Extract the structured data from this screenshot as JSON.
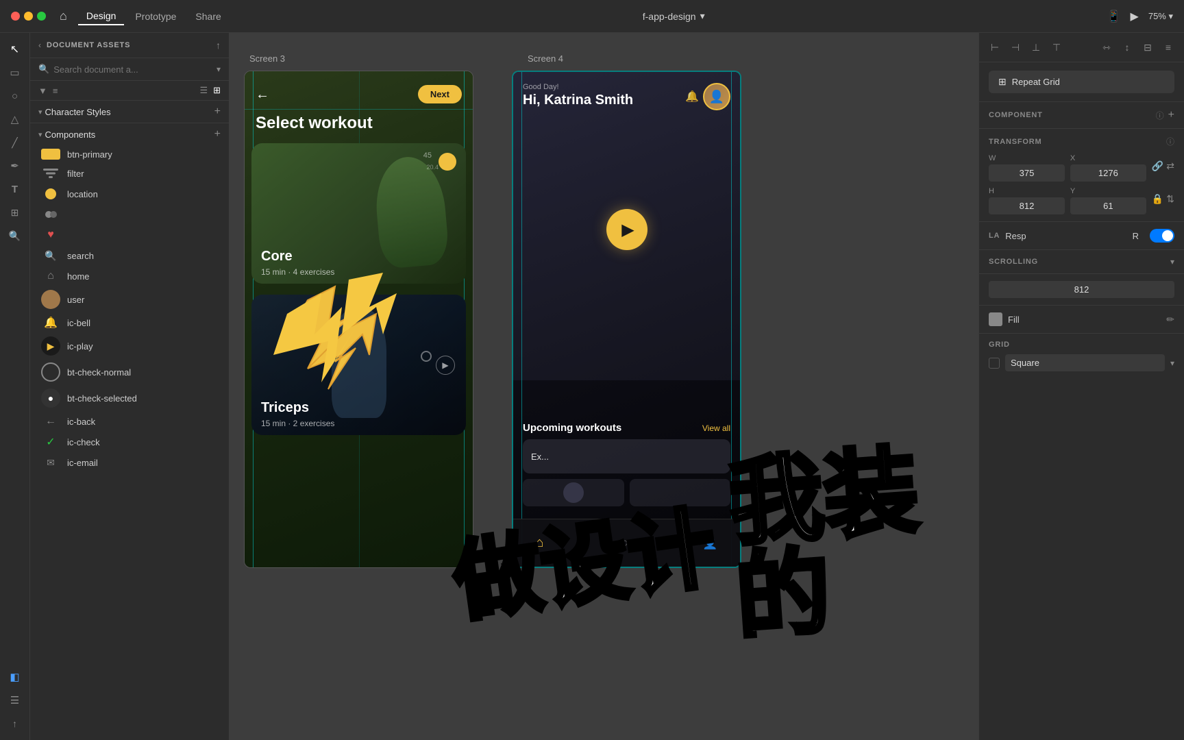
{
  "topbar": {
    "traffic": [
      "red",
      "yellow",
      "green"
    ],
    "nav_items": [
      "Design",
      "Prototype",
      "Share"
    ],
    "active_nav": "Design",
    "home_icon": "⌂",
    "title": "f-app-design",
    "title_arrow": "▾",
    "right_icons": [
      "📱",
      "▶",
      "75%",
      "▾"
    ]
  },
  "left_tools": {
    "tools": [
      {
        "name": "select",
        "icon": "↖",
        "active": true
      },
      {
        "name": "rectangle",
        "icon": "▭"
      },
      {
        "name": "ellipse",
        "icon": "○"
      },
      {
        "name": "polygon",
        "icon": "△"
      },
      {
        "name": "line",
        "icon": "╱"
      },
      {
        "name": "pen",
        "icon": "✒"
      },
      {
        "name": "text",
        "icon": "T"
      },
      {
        "name": "plugins",
        "icon": "⊞"
      },
      {
        "name": "search",
        "icon": "🔍"
      },
      {
        "name": "layers",
        "active": true,
        "icon": "◧"
      },
      {
        "name": "assets",
        "icon": "⊟"
      },
      {
        "name": "share",
        "icon": "↑"
      }
    ]
  },
  "sidebar": {
    "header_title": "DOCUMENT ASSETS",
    "search_placeholder": "Search document a...",
    "character_styles_label": "Character Styles",
    "components_label": "Components",
    "items": [
      {
        "name": "btn-primary",
        "type": "rect_yellow"
      },
      {
        "name": "filter",
        "type": "filter_icon"
      },
      {
        "name": "location",
        "type": "circle_yellow"
      },
      {
        "name": "user_stack",
        "type": "user_icon"
      },
      {
        "name": "heart",
        "type": "heart_icon"
      },
      {
        "name": "search",
        "type": "search_icon"
      },
      {
        "name": "home",
        "type": "home_icon"
      },
      {
        "name": "user",
        "type": "user_photo"
      },
      {
        "name": "ic-bell",
        "type": "bell_icon"
      },
      {
        "name": "ic-play",
        "type": "play_icon"
      },
      {
        "name": "bt-check-normal",
        "type": "check_normal"
      },
      {
        "name": "bt-check-selected",
        "type": "check_selected"
      },
      {
        "name": "ic-back",
        "type": "back_icon"
      },
      {
        "name": "ic-check",
        "type": "check_icon"
      },
      {
        "name": "ic-email",
        "type": "email_icon"
      }
    ]
  },
  "canvas": {
    "screen3": {
      "label": "Screen 3",
      "back_btn": "←",
      "next_btn": "Next",
      "title": "Select workout",
      "card1": {
        "title": "Core",
        "subtitle": "15 min · 4 exercises"
      },
      "card2": {
        "title": "Triceps",
        "subtitle": "15 min · 2 exercises"
      }
    },
    "screen4": {
      "label": "Screen 4",
      "good_day": "Good Day!",
      "greeting": "Hi, Katrina Smith",
      "upcoming_label": "Upcoming workouts",
      "view_all": "View all",
      "exercise_label": "Ex..."
    }
  },
  "right_panel": {
    "repeat_grid_label": "Repeat Grid",
    "component_label": "COMPONENT",
    "transform_label": "TRANSFORM",
    "w_label": "W",
    "h_label": "H",
    "x_label": "X",
    "y_label": "Y",
    "w_value": "375",
    "h_value": "812",
    "x_value": "1276",
    "y_value": "61",
    "layout_label": "LA",
    "responsive_label": "Resp",
    "responsive_value": "R",
    "scrolling_label": "SCROLLING",
    "height_value": "812",
    "fill_label": "Fill",
    "grid_label": "GRID",
    "grid_type": "Square"
  },
  "overlays": {
    "left_text": "做设计",
    "right_text": "我装的"
  }
}
